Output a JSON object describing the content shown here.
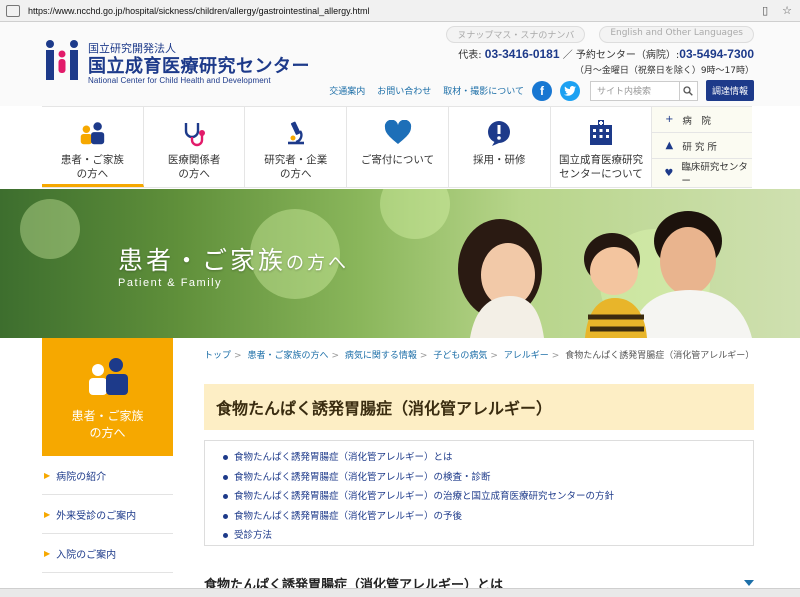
{
  "browser": {
    "url_prefix": "https://www.",
    "url_domain": "ncchd.go.jp",
    "url_path": "/hospital/sickness/children/allergy/gastrointestinal_allergy.html"
  },
  "header": {
    "org_type": "国立研究開発法人",
    "org_name": "国立成育医療研究センター",
    "org_name_en": "National Center for Child Health and Development",
    "top_link_1": "ヌナップマス・スナのナンバ",
    "top_link_2": "English and Other Languages",
    "phone_label": "代表:",
    "phone_main": "03-3416-0181",
    "reserve_label": "／ 予約センター（病院）:",
    "phone_reserve": "03-5494-7300",
    "hours": "（月～金曜日（祝祭日を除く）9時～17時）",
    "links": [
      "交通案内",
      "お問い合わせ",
      "取材・撮影について"
    ],
    "search_placeholder": "サイト内検索",
    "procurement": "調達情報"
  },
  "nav": {
    "items": [
      {
        "label": "患者・ご家族\nの方へ",
        "icon": "family-icon"
      },
      {
        "label": "医療関係者\nの方へ",
        "icon": "stethoscope-icon"
      },
      {
        "label": "研究者・企業\nの方へ",
        "icon": "microscope-icon"
      },
      {
        "label": "ご寄付について",
        "icon": "heart-icon"
      },
      {
        "label": "採用・研修",
        "icon": "exclamation-icon"
      },
      {
        "label": "国立成育医療研究\nセンターについて",
        "icon": "building-icon"
      }
    ],
    "side": [
      {
        "label": "病　院",
        "icon": "+"
      },
      {
        "label": "研 究 所",
        "icon": "▲"
      },
      {
        "label": "臨床研究センター",
        "icon": "♥"
      }
    ]
  },
  "hero": {
    "title_main": "患者・ご家族",
    "title_suffix": "の方へ",
    "subtitle": "Patient & Family"
  },
  "sidebar": {
    "title": "患者・ご家族\nの方へ",
    "items": [
      "病院の紹介",
      "外来受診のご案内",
      "入院のご案内"
    ]
  },
  "breadcrumb": {
    "items": [
      "トップ",
      "患者・ご家族の方へ",
      "病気に関する情報",
      "子どもの病気",
      "アレルギー"
    ],
    "current": "食物たんぱく誘発胃腸症（消化管アレルギー）"
  },
  "page": {
    "title": "食物たんぱく誘発胃腸症（消化管アレルギー）",
    "toc": [
      "食物たんぱく誘発胃腸症（消化管アレルギー）とは",
      "食物たんぱく誘発胃腸症（消化管アレルギー）の検査・診断",
      "食物たんぱく誘発胃腸症（消化管アレルギー）の治療と国立成育医療研究センターの方針",
      "食物たんぱく誘発胃腸症（消化管アレルギー）の予後",
      "受診方法"
    ],
    "section_heading": "食物たんぱく誘発胃腸症（消化管アレルギー）とは"
  },
  "colors": {
    "brand_blue": "#1d3a8a",
    "accent_orange": "#f6a800",
    "title_bg": "#fdeec5"
  }
}
